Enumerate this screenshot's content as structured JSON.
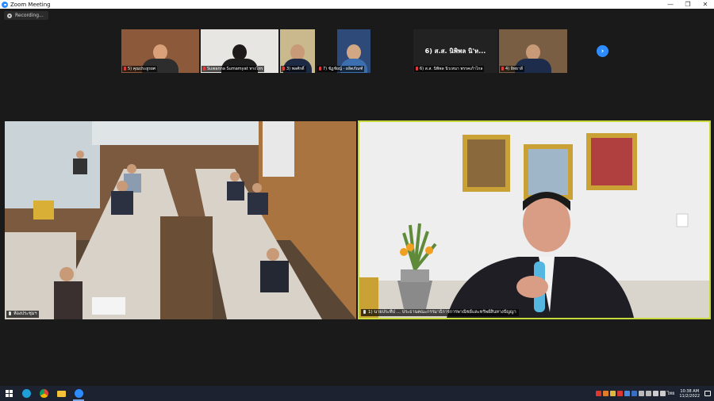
{
  "window": {
    "title": "Zoom Meeting",
    "controls": [
      "—",
      "❐",
      "✕"
    ]
  },
  "recording": {
    "label": "Recording..."
  },
  "thumbnails": [
    {
      "label": "5) คุณประยูรยศ",
      "bg": "#8c5a3a",
      "head": "#d9a07a",
      "body": "#2d2d2d"
    },
    {
      "label": "Suwanna Sumamyat ทางโทร",
      "bg": "#e8e6e2",
      "head": "#1e1a1a",
      "body": "#1f1f1f"
    },
    {
      "label": "3) พลศักดิ์",
      "bg": "#c9b98c",
      "head": "#c89a78",
      "body": "#1e2a44"
    },
    {
      "label": "7) ชัฏชัยญ์ - ผลิตภัณฑ์",
      "bg": "#2e4a78",
      "head": "#d2a884",
      "body": "#3b6fb0"
    },
    {
      "label": "6) ส.ส. นิพิพล นิวเหนา พรรคเก้าไกล",
      "name_only": "6) ส.ส. นิพิพล นิ'ห...",
      "bg": "#222222"
    },
    {
      "label": "4) อิทธาลี",
      "bg": "#7a5e44",
      "head": "#c89a78",
      "body": "#1c2c4a"
    }
  ],
  "main_tiles": {
    "left_label": "ห้องประชุมฯ",
    "right_label": "1) นายประทีป ... ประธานคณะกรรมาธิการการพาณิชย์และทรัพย์สินทางปัญญา"
  },
  "taskbar": {
    "language": "ไทย",
    "time": "10:38 AM",
    "date": "11/2/2022"
  },
  "colors": {
    "active_speaker_border": "#c7d93a",
    "zoom_blue": "#2d8cff",
    "taskbar": "#1c2230"
  }
}
